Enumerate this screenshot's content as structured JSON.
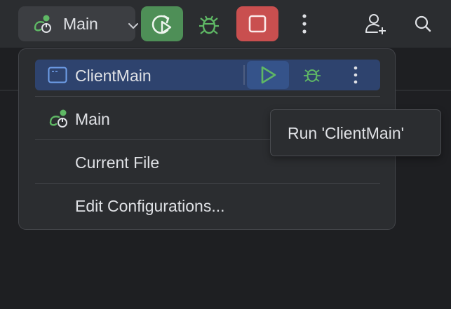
{
  "toolbar": {
    "config_name": "Main",
    "rerun_button": "rerun-icon",
    "debug_button": "debug-icon",
    "stop_button": "stop-icon",
    "more_button": "more-vertical-icon",
    "add_user_button": "add-user-icon",
    "search_button": "search-icon"
  },
  "popup": {
    "items": [
      {
        "label": "ClientMain",
        "icon": "class-icon",
        "selected": true
      },
      {
        "label": "Main",
        "icon": "run-config-icon"
      },
      {
        "label": "Current File"
      },
      {
        "label": "Edit Configurations..."
      }
    ]
  },
  "tooltip": {
    "text": "Run 'ClientMain'"
  },
  "colors": {
    "toolbar_bg": "#2b2d30",
    "editor_bg": "#1e1f22",
    "rerun_green": "#4e8f57",
    "stop_red": "#c94f4f",
    "selection_blue": "#2e436e",
    "icon_green": "#5fb865"
  }
}
